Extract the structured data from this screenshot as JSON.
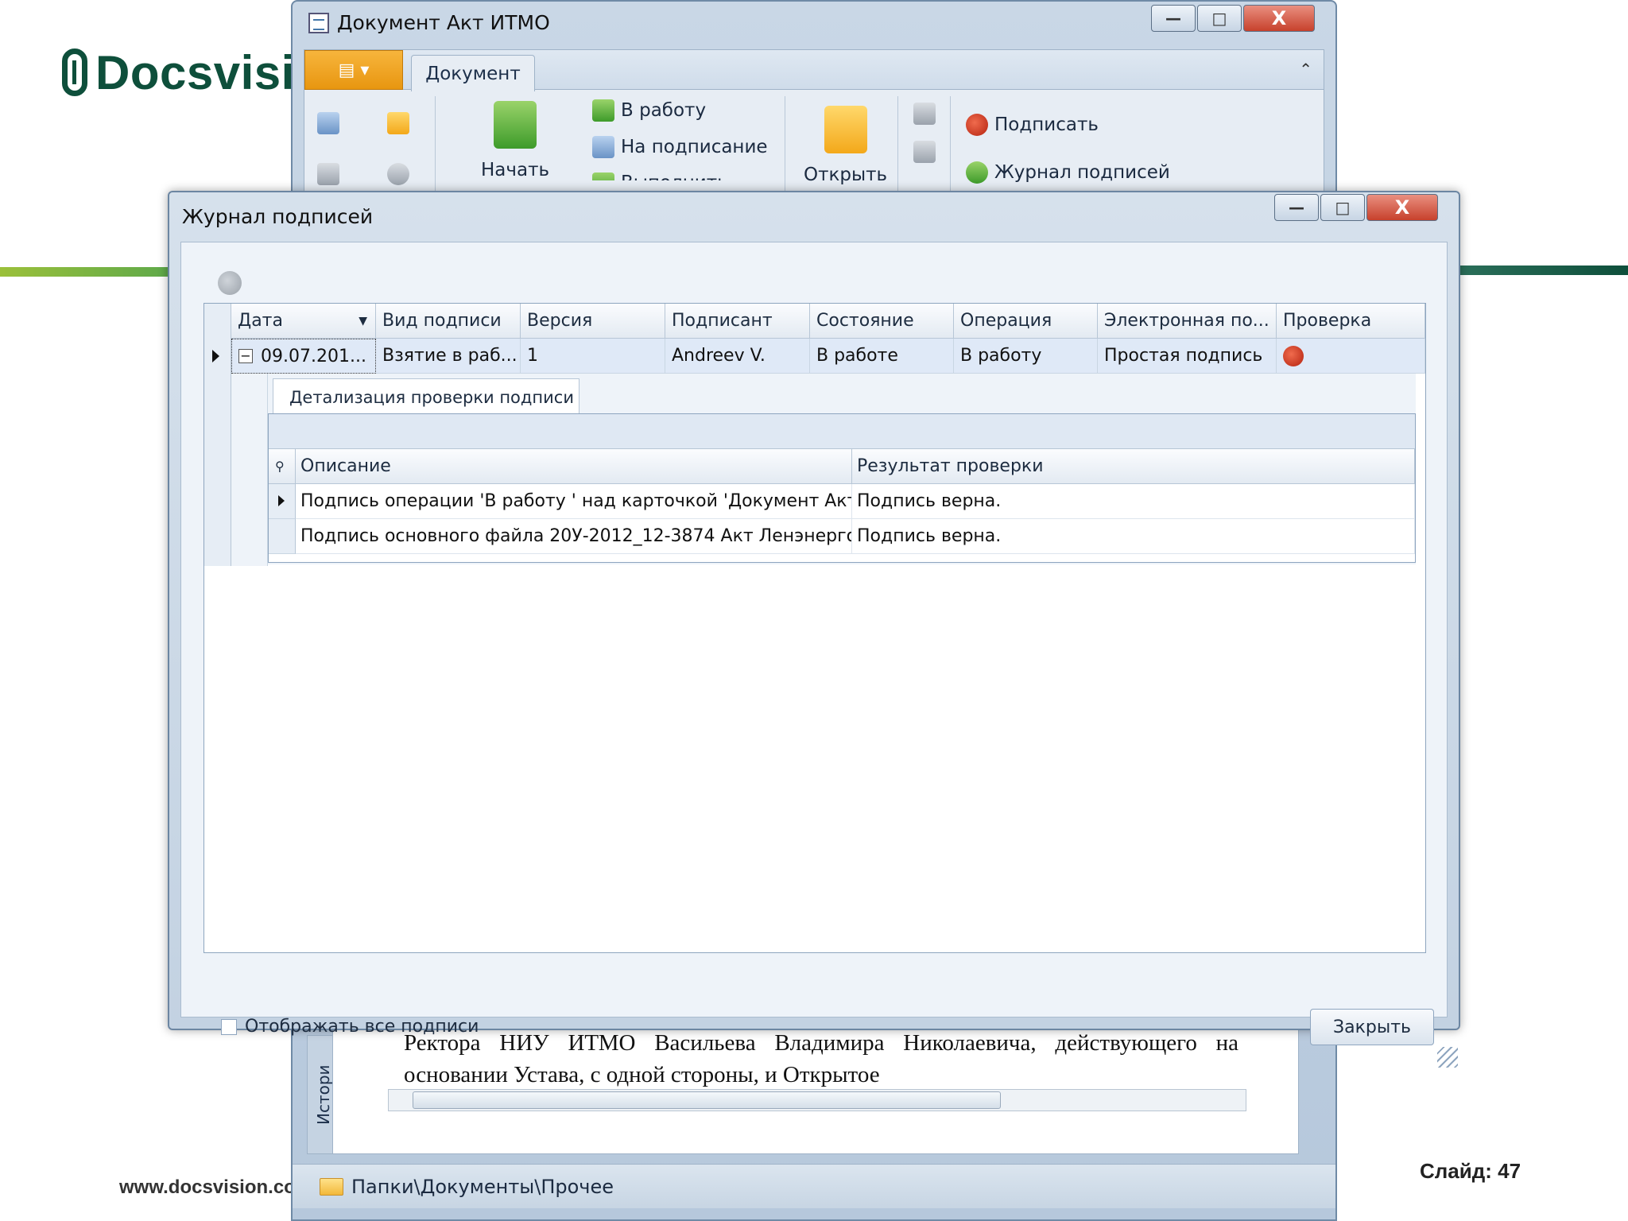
{
  "slide": {
    "logo_text": "Docsvisio",
    "site_url": "www.docsvision.co",
    "slide_number": "Слайд: 47",
    "brand_color": "#0e4f3b",
    "accent_color": "#8cc63f"
  },
  "main_window": {
    "title": "Документ Акт ИТМО",
    "ribbon": {
      "tab": "Документ",
      "buttons": {
        "start": "Начать",
        "to_work": "В работу",
        "to_sign": "На подписание",
        "execute": "Выполнить",
        "open": "Открыть",
        "sign": "Подписать",
        "sign_journal": "Журнал подписей"
      }
    },
    "history_tab": "Истори",
    "document_text": "Ректора НИУ ИТМО Васильева Владимира Николаевича, действующего на основании Устава, с одной стороны, и Открытое",
    "status_path": "Папки\\Документы\\Прочее"
  },
  "dialog": {
    "title": "Журнал подписей",
    "columns": [
      "Дата",
      "Вид подписи",
      "Версия",
      "Подписант",
      "Состояние",
      "Операция",
      "Электронная по...",
      "Проверка"
    ],
    "rows": [
      {
        "date": "09.07.201...",
        "sign_type": "Взятие в раб...",
        "version": "1",
        "signer": "Andreev V.",
        "state": "В работе",
        "operation": "В работу",
        "esign": "Простая подпись",
        "check_icon": "verified-seal-icon"
      }
    ],
    "detail": {
      "tab": "Детализация проверки подписи",
      "columns": [
        "Описание",
        "Результат проверки"
      ],
      "rows": [
        {
          "description": "Подпись операции 'В работу ' над карточкой 'Документ Акт ...",
          "result": "Подпись верна."
        },
        {
          "description": "Подпись основного файла 20У-2012_12-3874 Акт Ленэнерго...",
          "result": "Подпись верна."
        }
      ]
    },
    "show_all_label": "Отображать все подписи",
    "close_button": "Закрыть"
  }
}
